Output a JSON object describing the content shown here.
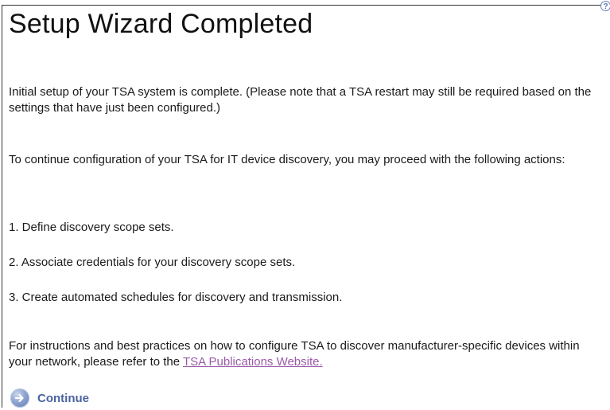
{
  "page": {
    "title": "Setup Wizard Completed",
    "intro": "Initial setup of your TSA system is complete. (Please note that a TSA restart may still be required based on the settings that have just been configured.)",
    "continue_text": "To continue configuration of your TSA for IT device discovery, you may proceed with the following actions:",
    "steps": [
      "1. Define discovery scope sets.",
      "2. Associate credentials for your discovery scope sets.",
      "3. Create automated schedules for discovery and transmission."
    ],
    "instructions_text": "For instructions and best practices on how to configure TSA to discover manufacturer-specific devices within your network, please refer to the ",
    "publications_link": "TSA Publications Website."
  },
  "buttons": {
    "continue_label": "Continue",
    "help_glyph": "?"
  },
  "icons": {
    "help": "help-icon",
    "continue": "arrow-right-circle-icon"
  },
  "colors": {
    "link": "#9a5aa8",
    "continue_label": "#4a63a0",
    "continue_icon": "#7c93c8"
  }
}
